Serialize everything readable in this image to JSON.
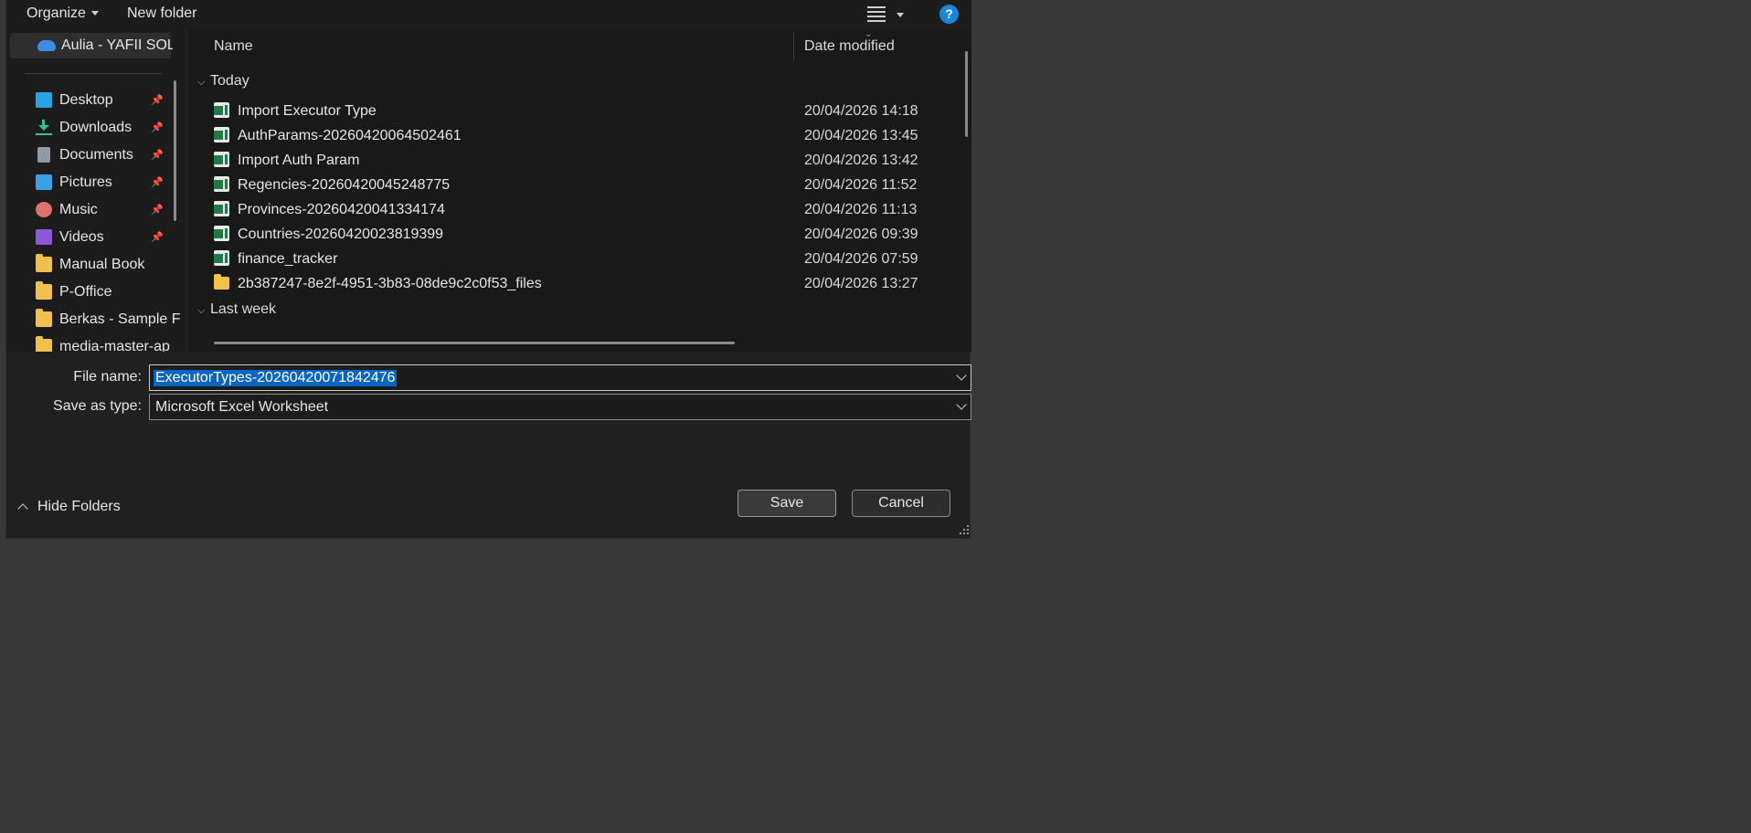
{
  "toolbar": {
    "organize": "Organize",
    "new_folder": "New folder",
    "help": "?"
  },
  "nav": {
    "onedrive": "Aulia - YAFII SOLU",
    "items": [
      {
        "label": "Desktop",
        "icon": "desktop-icon",
        "pinned": true
      },
      {
        "label": "Downloads",
        "icon": "downloads-icon",
        "pinned": true
      },
      {
        "label": "Documents",
        "icon": "documents-icon",
        "pinned": true
      },
      {
        "label": "Pictures",
        "icon": "pictures-icon",
        "pinned": true
      },
      {
        "label": "Music",
        "icon": "music-icon",
        "pinned": true
      },
      {
        "label": "Videos",
        "icon": "videos-icon",
        "pinned": true
      },
      {
        "label": "Manual Book",
        "icon": "folder-icon",
        "pinned": false
      },
      {
        "label": "P-Office",
        "icon": "folder-icon",
        "pinned": false
      },
      {
        "label": "Berkas - Sample F",
        "icon": "folder-icon",
        "pinned": false
      },
      {
        "label": "media-master-ap",
        "icon": "folder-icon",
        "pinned": false
      }
    ]
  },
  "files": {
    "columns": {
      "name": "Name",
      "date": "Date modified"
    },
    "groups": [
      {
        "label": "Today",
        "rows": [
          {
            "name": "Import Executor Type",
            "date": "20/04/2026 14:18",
            "type": "excel"
          },
          {
            "name": "AuthParams-20260420064502461",
            "date": "20/04/2026 13:45",
            "type": "excel"
          },
          {
            "name": "Import Auth Param",
            "date": "20/04/2026 13:42",
            "type": "excel"
          },
          {
            "name": "Regencies-20260420045248775",
            "date": "20/04/2026 11:52",
            "type": "excel"
          },
          {
            "name": "Provinces-20260420041334174",
            "date": "20/04/2026 11:13",
            "type": "excel"
          },
          {
            "name": "Countries-20260420023819399",
            "date": "20/04/2026 09:39",
            "type": "excel"
          },
          {
            "name": "finance_tracker",
            "date": "20/04/2026 07:59",
            "type": "excel"
          },
          {
            "name": "2b387247-8e2f-4951-3b83-08de9c2c0f53_files",
            "date": "20/04/2026 13:27",
            "type": "folder"
          }
        ]
      },
      {
        "label": "Last week",
        "rows": []
      }
    ]
  },
  "form": {
    "file_name_label": "File name:",
    "file_name_value": "ExecutorTypes-20260420071842476",
    "save_type_label": "Save as type:",
    "save_type_value": "Microsoft Excel Worksheet"
  },
  "footer": {
    "hide_folders": "Hide Folders",
    "save": "Save",
    "cancel": "Cancel"
  },
  "colors": {
    "background": "#383838",
    "dialog": "#202020",
    "selection": "#0a64c2",
    "help_badge": "#1a86d9"
  }
}
